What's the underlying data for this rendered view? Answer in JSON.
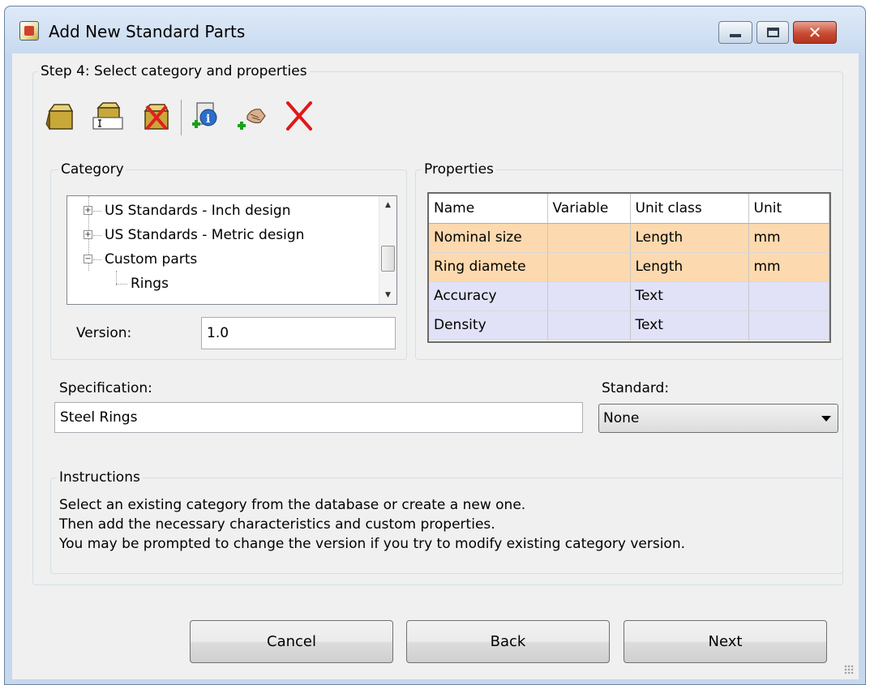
{
  "window": {
    "title": "Add New Standard Parts",
    "controls": {
      "minimize": "–",
      "maximize": "□",
      "close": "✕"
    }
  },
  "step": {
    "label": "Step 4: Select category and properties"
  },
  "toolbar": {
    "icons": [
      "new-category-icon",
      "rename-category-icon",
      "delete-category-icon",
      "add-property-icon",
      "add-custom-property-icon",
      "delete-property-icon"
    ]
  },
  "category": {
    "label": "Category",
    "tree": [
      {
        "label": "US Standards - Inch design",
        "expander": "+"
      },
      {
        "label": "US Standards - Metric design",
        "expander": "+"
      },
      {
        "label": "Custom parts",
        "expander": "−"
      },
      {
        "label": "Rings"
      }
    ],
    "version_label": "Version:",
    "version_value": "1.0"
  },
  "properties": {
    "label": "Properties",
    "columns": [
      "Name",
      "Variable",
      "Unit class",
      "Unit"
    ],
    "rows": [
      {
        "name": "Nominal size",
        "variable": "",
        "unit_class": "Length",
        "unit": "mm",
        "kind": "required"
      },
      {
        "name": "Ring diamete",
        "variable": "",
        "unit_class": "Length",
        "unit": "mm",
        "kind": "required"
      },
      {
        "name": "Accuracy",
        "variable": "",
        "unit_class": "Text",
        "unit": "",
        "kind": "optional"
      },
      {
        "name": "Density",
        "variable": "",
        "unit_class": "Text",
        "unit": "",
        "kind": "optional"
      }
    ]
  },
  "specification": {
    "label": "Specification:",
    "value": "Steel Rings"
  },
  "standard": {
    "label": "Standard:",
    "selected": "None"
  },
  "instructions": {
    "label": "Instructions",
    "lines": [
      "Select an existing category from the database or create a new one.",
      "Then add the necessary characteristics and custom properties.",
      "You may be prompted to change the version if you try to modify existing category version."
    ]
  },
  "buttons": {
    "cancel": "Cancel",
    "back": "Back",
    "next": "Next"
  },
  "colors": {
    "required_row": "#fcd9ae",
    "optional_row": "#e1e1f7",
    "window_frame": "#c5d8ee",
    "close_button": "#c84b33"
  }
}
